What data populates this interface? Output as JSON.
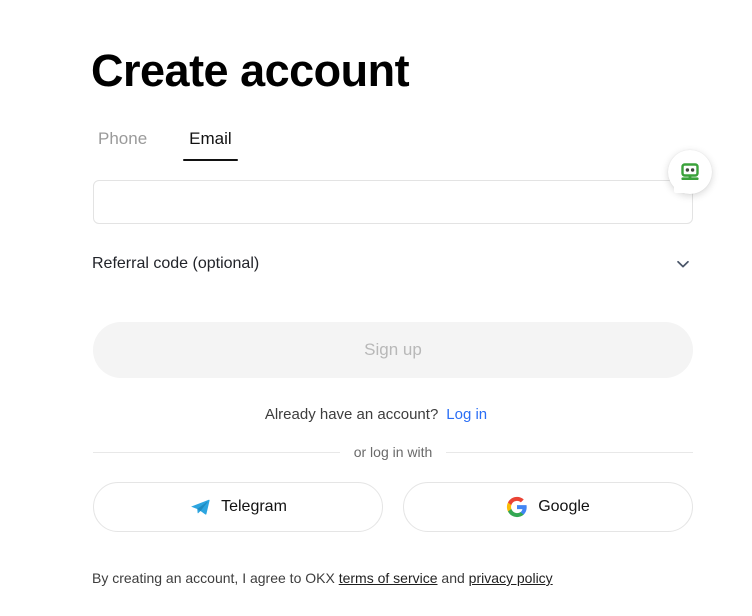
{
  "page": {
    "title": "Create account"
  },
  "tabs": [
    {
      "label": "Phone",
      "active": false
    },
    {
      "label": "Email",
      "active": true
    }
  ],
  "form": {
    "email_value": "",
    "email_placeholder": "",
    "captcha_icon": "robot-icon",
    "referral_label": "Referral code (optional)",
    "referral_chevron_icon": "chevron-down-icon",
    "submit_label": "Sign up"
  },
  "account": {
    "prompt": "Already have an account?",
    "login_label": "Log in"
  },
  "divider": {
    "text": "or log in with"
  },
  "social": [
    {
      "label": "Telegram",
      "icon": "telegram-icon"
    },
    {
      "label": "Google",
      "icon": "google-icon"
    }
  ],
  "legal": {
    "prefix": "By creating an account, I agree to OKX",
    "terms_label": "terms of service",
    "conjunction": "and",
    "privacy_label": "privacy policy"
  },
  "colors": {
    "accent_link": "#2a6ef5",
    "telegram_blue": "#2ca5e0",
    "captcha_green": "#3ba23b",
    "tab_active": "#121212",
    "tab_inactive": "#9a9a9a",
    "button_disabled_bg": "#f4f4f4",
    "button_disabled_text": "#b8b8b8"
  }
}
